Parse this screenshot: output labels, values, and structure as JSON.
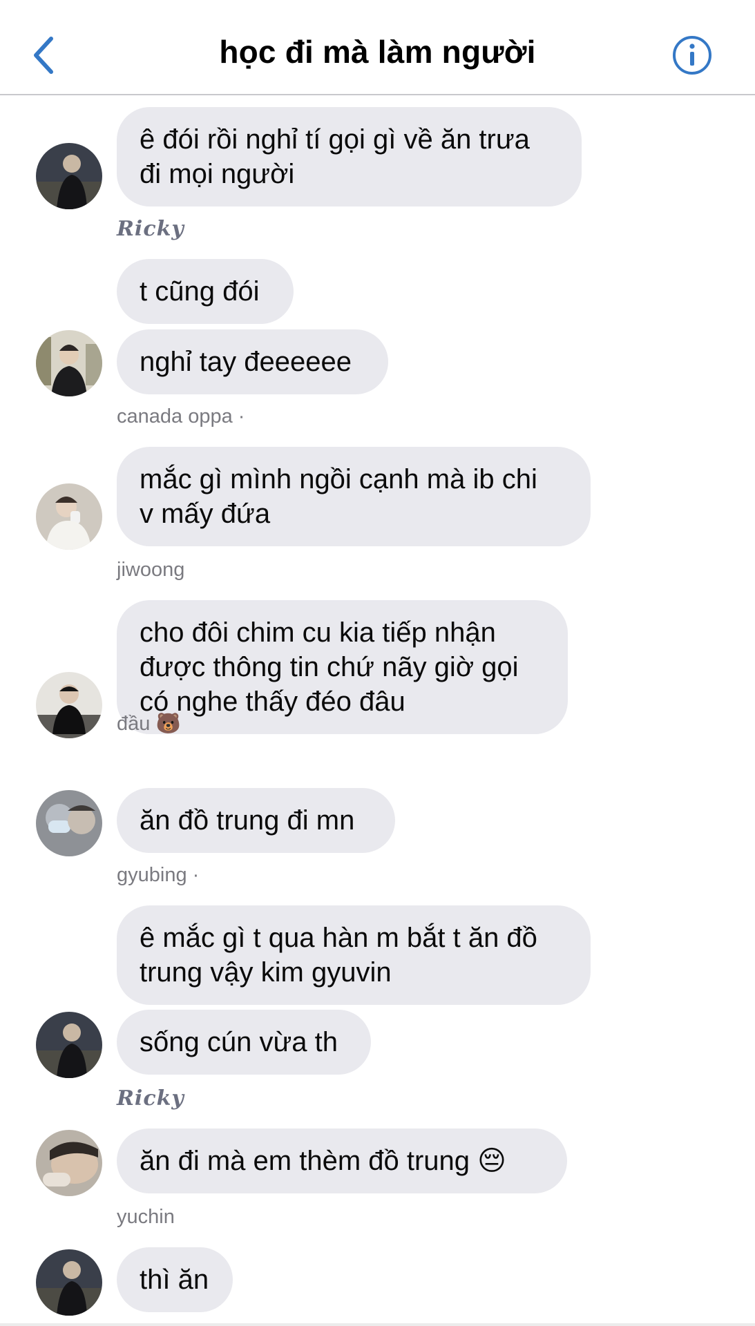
{
  "header": {
    "back_icon": "chevron-left-icon",
    "title": "học đi mà làm người",
    "info_icon": "info-circle-icon",
    "accent_color": "#3478c6"
  },
  "messages": [
    {
      "text": "ê đói rồi nghỉ tí gọi gì về ăn trưa\nđi mọi người"
    },
    {
      "text": "t cũng đói"
    },
    {
      "text": "nghỉ tay đeeeeee"
    },
    {
      "text": "mắc gì mình ngồi cạnh mà ib chi\nv mấy đứa"
    },
    {
      "text": "cho đôi chim cu kia tiếp nhận\nđược thông tin chứ nãy giờ gọi\ncó nghe thấy đéo đâu"
    },
    {
      "text": "ăn đồ trung đi mn"
    },
    {
      "text": "ê mắc gì t qua hàn m bắt t ăn đồ\ntrung vậy kim gyuvin"
    },
    {
      "text": "sống cún vừa th"
    },
    {
      "text": "ăn đi mà em thèm đồ trung 😔"
    },
    {
      "text": "thì ăn"
    }
  ],
  "senders": [
    {
      "name": "Ricky"
    },
    {
      "name": "canada oppa ·"
    },
    {
      "name": "jiwoong"
    },
    {
      "name": "đầu 🐻"
    },
    {
      "name": "gyubing ·"
    },
    {
      "name": "Ricky"
    },
    {
      "name": "yuchin"
    }
  ],
  "colors": {
    "bubble": "#e9e9ee",
    "sender_text": "#7a7a80",
    "divider": "#c8c8cc"
  }
}
